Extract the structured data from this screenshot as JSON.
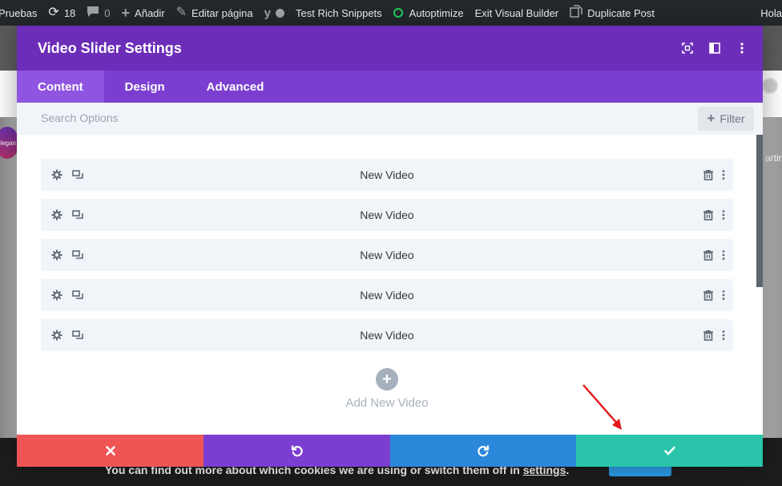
{
  "adminbar": {
    "site_name": "Pruebas",
    "updates_count": "18",
    "comments_count": "0",
    "new_label": "Añadir",
    "edit_label": "Editar página",
    "rich_snippets_label": "Test Rich Snippets",
    "autoptimize_label": "Autoptimize",
    "exit_builder_label": "Exit Visual Builder",
    "duplicate_label": "Duplicate Post",
    "greeting": "Hola"
  },
  "background": {
    "right_text": "artir",
    "avatar_text": "legan"
  },
  "modal": {
    "title": "Video Slider Settings",
    "header_icons": [
      "focus-icon",
      "split-view-icon",
      "more-vertical-icon"
    ],
    "tabs": [
      {
        "label": "Content",
        "active": true
      },
      {
        "label": "Design",
        "active": false
      },
      {
        "label": "Advanced",
        "active": false
      }
    ],
    "search": {
      "placeholder": "Search Options",
      "value": ""
    },
    "filter_label": "Filter",
    "items": [
      {
        "label": "New Video"
      },
      {
        "label": "New Video"
      },
      {
        "label": "New Video"
      },
      {
        "label": "New Video"
      },
      {
        "label": "New Video"
      }
    ],
    "add_label": "Add New Video"
  },
  "footer": {
    "buttons": [
      "cancel-icon",
      "undo-icon",
      "redo-icon",
      "check-icon"
    ],
    "colors": {
      "cancel": "#ef5555",
      "undo": "#7b3ed0",
      "redo": "#2b87da",
      "save": "#29c4a9"
    }
  },
  "cookie": {
    "text_before": "You can find out more about which cookies we are using or switch them off in ",
    "link_text": "settings",
    "text_after": "."
  },
  "colors": {
    "brand_purple": "#6c2eb9",
    "tab_purple": "#7b3ed0",
    "annotation_arrow": "#e3191c"
  }
}
